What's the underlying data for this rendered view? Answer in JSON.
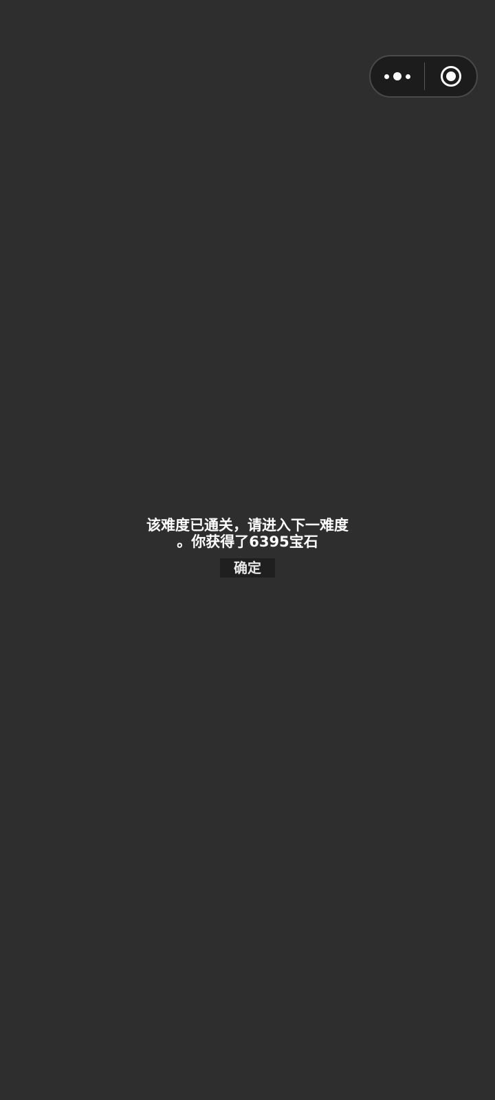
{
  "capsule": {
    "more_icon": "more-dots-icon",
    "close_icon": "target-circle-icon"
  },
  "dialog": {
    "message_line1": "该难度已通关，请进入下一难度",
    "message_line2": "。你获得了6395宝石",
    "confirm_label": "确定"
  },
  "colors": {
    "background": "#2e2e2e",
    "capsule_background": "#1c1c1c",
    "button_background": "#1f1f1f",
    "text": "#ffffff"
  }
}
